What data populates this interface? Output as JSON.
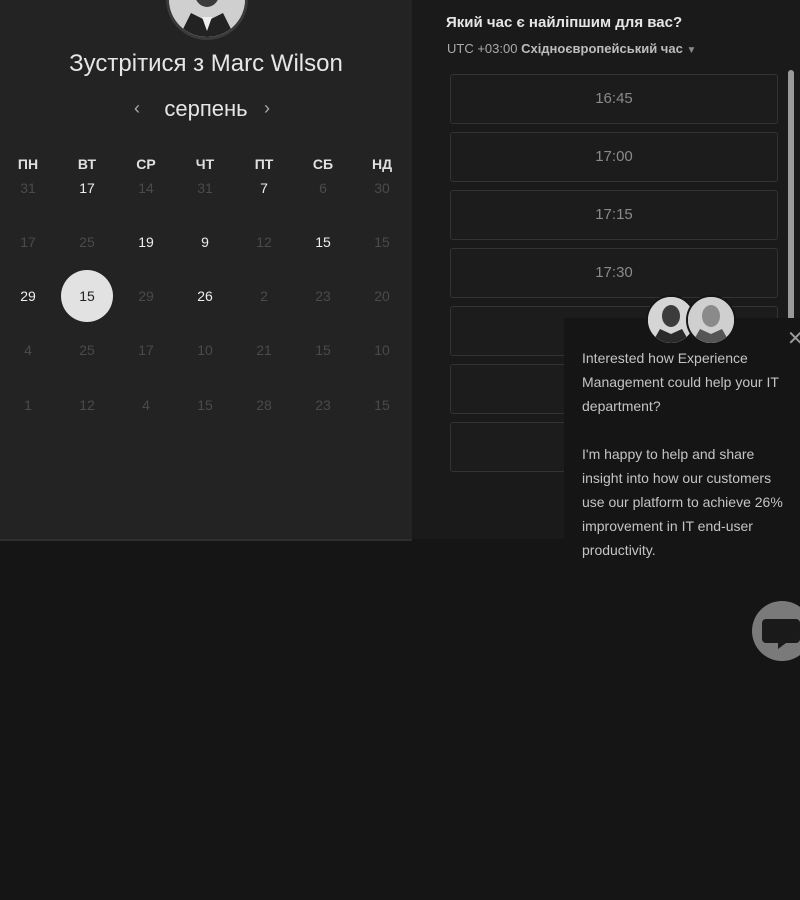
{
  "calendar": {
    "title": "Зустрітися з Marc Wilson",
    "month": "серпень",
    "weekdays": [
      "ПН",
      "ВТ",
      "СР",
      "ЧТ",
      "ПТ",
      "СБ",
      "НД"
    ],
    "weeks": [
      [
        {
          "d": "31",
          "s": "off"
        },
        {
          "d": "17",
          "s": "on"
        },
        {
          "d": "14",
          "s": "off"
        },
        {
          "d": "31",
          "s": "off"
        },
        {
          "d": "7",
          "s": "on"
        },
        {
          "d": "6",
          "s": "off"
        },
        {
          "d": "30",
          "s": "off"
        }
      ],
      [
        {
          "d": "17",
          "s": "off"
        },
        {
          "d": "25",
          "s": "off"
        },
        {
          "d": "19",
          "s": "on"
        },
        {
          "d": "9",
          "s": "on"
        },
        {
          "d": "12",
          "s": "off"
        },
        {
          "d": "15",
          "s": "on"
        },
        {
          "d": "15",
          "s": "off"
        }
      ],
      [
        {
          "d": "29",
          "s": "on"
        },
        {
          "d": "15",
          "s": "selected"
        },
        {
          "d": "29",
          "s": "off"
        },
        {
          "d": "26",
          "s": "on"
        },
        {
          "d": "2",
          "s": "off"
        },
        {
          "d": "23",
          "s": "off"
        },
        {
          "d": "20",
          "s": "off"
        }
      ],
      [
        {
          "d": "4",
          "s": "off"
        },
        {
          "d": "25",
          "s": "off"
        },
        {
          "d": "17",
          "s": "off"
        },
        {
          "d": "10",
          "s": "off"
        },
        {
          "d": "21",
          "s": "off"
        },
        {
          "d": "15",
          "s": "off"
        },
        {
          "d": "10",
          "s": "off"
        }
      ],
      [
        {
          "d": "1",
          "s": "off"
        },
        {
          "d": "12",
          "s": "off"
        },
        {
          "d": "4",
          "s": "off"
        },
        {
          "d": "15",
          "s": "off"
        },
        {
          "d": "28",
          "s": "off"
        },
        {
          "d": "23",
          "s": "off"
        },
        {
          "d": "15",
          "s": "off"
        }
      ]
    ]
  },
  "timezone": {
    "question": "Який час є найліпшим для вас?",
    "offset": "UTC +03:00",
    "name": "Східноєвропейський час"
  },
  "time_slots": [
    "16:45",
    "17:00",
    "17:15",
    "17:30",
    "",
    "",
    ""
  ],
  "chat_popup": {
    "paragraph1": "Interested how Experience Management could help your IT department?",
    "paragraph2": "I'm happy to help and share insight into how our customers use our platform to achieve 26% improvement in IT end-user productivity."
  },
  "icons": {
    "prev": "chevron-left-icon",
    "next": "chevron-right-icon",
    "dropdown": "caret-down-icon",
    "close": "close-icon",
    "chat": "chat-bubble-icon"
  }
}
